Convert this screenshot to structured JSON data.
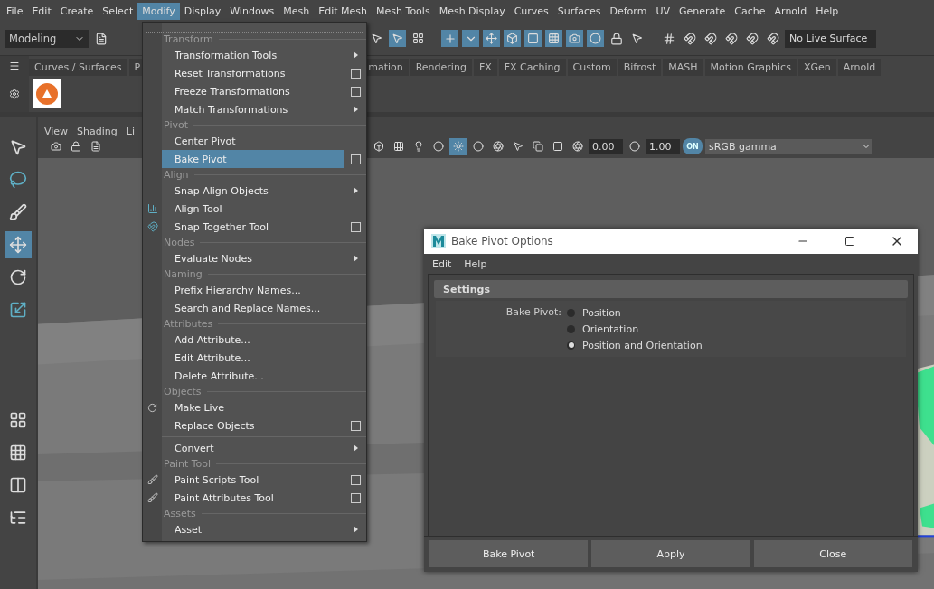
{
  "menu_bar": [
    {
      "label": "File",
      "selected": false
    },
    {
      "label": "Edit",
      "selected": false
    },
    {
      "label": "Create",
      "selected": false
    },
    {
      "label": "Select",
      "selected": false
    },
    {
      "label": "Modify",
      "selected": true
    },
    {
      "label": "Display",
      "selected": false
    },
    {
      "label": "Windows",
      "selected": false
    },
    {
      "label": "Mesh",
      "selected": false
    },
    {
      "label": "Edit Mesh",
      "selected": false
    },
    {
      "label": "Mesh Tools",
      "selected": false
    },
    {
      "label": "Mesh Display",
      "selected": false
    },
    {
      "label": "Curves",
      "selected": false
    },
    {
      "label": "Surfaces",
      "selected": false
    },
    {
      "label": "Deform",
      "selected": false
    },
    {
      "label": "UV",
      "selected": false
    },
    {
      "label": "Generate",
      "selected": false
    },
    {
      "label": "Cache",
      "selected": false
    },
    {
      "label": "Arnold",
      "selected": false
    },
    {
      "label": "Help",
      "selected": false
    }
  ],
  "toolbar": {
    "workspace": "Modeling",
    "live_surface": "No Live Surface"
  },
  "shelf_tabs": [
    "Curves / Surfaces",
    "P",
    "mation",
    "Rendering",
    "FX",
    "FX Caching",
    "Custom",
    "Bifrost",
    "MASH",
    "Motion Graphics",
    "XGen",
    "Arnold"
  ],
  "viewport": {
    "menu": [
      "View",
      "Shading",
      "Li"
    ],
    "exposure": "0.00",
    "gamma": "1.00",
    "color_management": "ON",
    "view_transform": "sRGB gamma"
  },
  "modify_menu": [
    {
      "kind": "header",
      "label": "Transform"
    },
    {
      "kind": "item",
      "label": "Transformation Tools",
      "submenu": true,
      "option_box": false,
      "selected": false
    },
    {
      "kind": "item",
      "label": "Reset Transformations",
      "submenu": false,
      "option_box": true,
      "selected": false
    },
    {
      "kind": "item",
      "label": "Freeze Transformations",
      "submenu": false,
      "option_box": true,
      "selected": false
    },
    {
      "kind": "item",
      "label": "Match Transformations",
      "submenu": true,
      "option_box": false,
      "selected": false
    },
    {
      "kind": "header",
      "label": "Pivot"
    },
    {
      "kind": "item",
      "label": "Center Pivot",
      "submenu": false,
      "option_box": false,
      "selected": false
    },
    {
      "kind": "item",
      "label": "Bake Pivot",
      "submenu": false,
      "option_box": true,
      "selected": true
    },
    {
      "kind": "header",
      "label": "Align"
    },
    {
      "kind": "item",
      "label": "Snap Align Objects",
      "submenu": true,
      "option_box": false,
      "selected": false
    },
    {
      "kind": "item",
      "label": "Align Tool",
      "submenu": false,
      "option_box": false,
      "selected": false
    },
    {
      "kind": "item",
      "label": "Snap Together Tool",
      "submenu": false,
      "option_box": true,
      "selected": false
    },
    {
      "kind": "header",
      "label": "Nodes"
    },
    {
      "kind": "item",
      "label": "Evaluate Nodes",
      "submenu": true,
      "option_box": false,
      "selected": false
    },
    {
      "kind": "header",
      "label": "Naming"
    },
    {
      "kind": "item",
      "label": "Prefix Hierarchy Names...",
      "submenu": false,
      "option_box": false,
      "selected": false
    },
    {
      "kind": "item",
      "label": "Search and Replace Names...",
      "submenu": false,
      "option_box": false,
      "selected": false
    },
    {
      "kind": "header",
      "label": "Attributes"
    },
    {
      "kind": "item",
      "label": "Add Attribute...",
      "submenu": false,
      "option_box": false,
      "selected": false
    },
    {
      "kind": "item",
      "label": "Edit Attribute...",
      "submenu": false,
      "option_box": false,
      "selected": false
    },
    {
      "kind": "item",
      "label": "Delete Attribute...",
      "submenu": false,
      "option_box": false,
      "selected": false
    },
    {
      "kind": "header",
      "label": "Objects"
    },
    {
      "kind": "item",
      "label": "Make Live",
      "submenu": false,
      "option_box": false,
      "selected": false
    },
    {
      "kind": "item",
      "label": "Replace Objects",
      "submenu": false,
      "option_box": true,
      "selected": false
    },
    {
      "kind": "separator"
    },
    {
      "kind": "item",
      "label": "Convert",
      "submenu": true,
      "option_box": false,
      "selected": false
    },
    {
      "kind": "header",
      "label": "Paint Tool"
    },
    {
      "kind": "item",
      "label": "Paint Scripts Tool",
      "submenu": false,
      "option_box": true,
      "selected": false
    },
    {
      "kind": "item",
      "label": "Paint Attributes Tool",
      "submenu": false,
      "option_box": true,
      "selected": false
    },
    {
      "kind": "header",
      "label": "Assets"
    },
    {
      "kind": "item",
      "label": "Asset",
      "submenu": true,
      "option_box": false,
      "selected": false
    }
  ],
  "dialog": {
    "title": "Bake Pivot Options",
    "menu": [
      "Edit",
      "Help"
    ],
    "section": "Settings",
    "field_label": "Bake Pivot:",
    "options": [
      {
        "label": "Position",
        "selected": false
      },
      {
        "label": "Orientation",
        "selected": false
      },
      {
        "label": "Position and Orientation",
        "selected": true
      }
    ],
    "buttons": [
      "Bake Pivot",
      "Apply",
      "Close"
    ]
  }
}
